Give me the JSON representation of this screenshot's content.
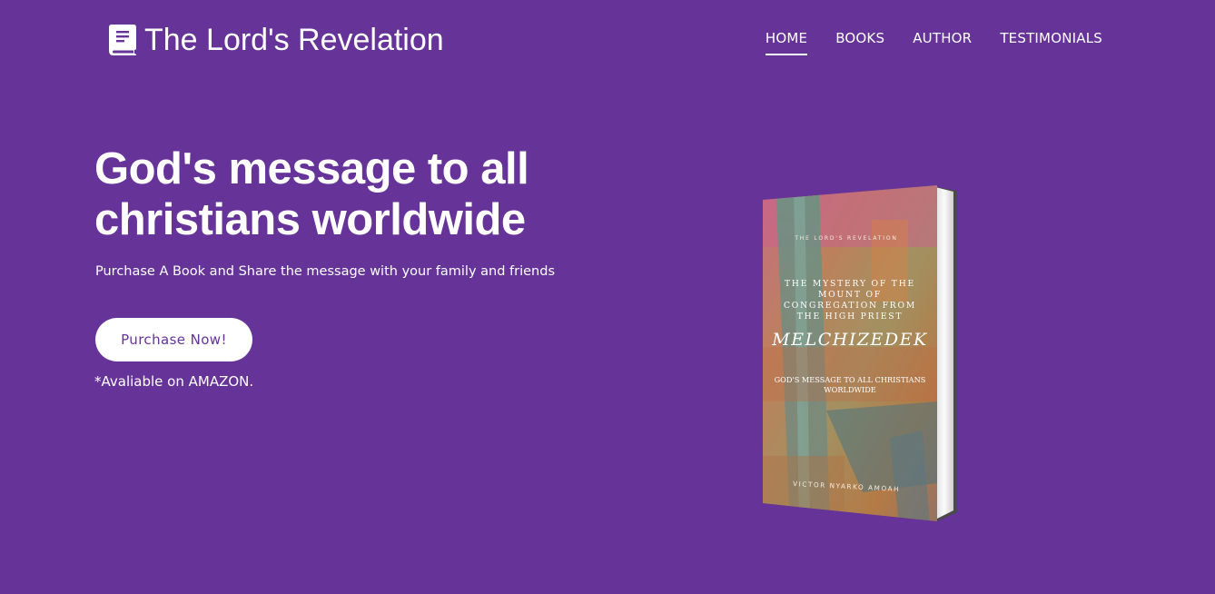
{
  "header": {
    "brand_icon": "book-icon",
    "brand_title": "The Lord's Revelation",
    "nav": [
      {
        "label": "HOME",
        "active": true
      },
      {
        "label": "BOOKS",
        "active": false
      },
      {
        "label": "AUTHOR",
        "active": false
      },
      {
        "label": "TESTIMONIALS",
        "active": false
      }
    ]
  },
  "hero": {
    "title": "God's message to all christians worldwide",
    "subtitle": "Purchase A Book and Share the message with your family and friends",
    "cta_label": "Purchase Now!",
    "note": "*Avaliable on AMAZON."
  },
  "book_cover": {
    "series": "THE LORD'S REVELATION",
    "title_lines": [
      "THE MYSTERY OF THE",
      "MOUNT OF",
      "CONGREGATION FROM",
      "THE HIGH PRIEST"
    ],
    "name": "MELCHIZEDEK",
    "subtitle_lines": [
      "GOD'S MESSAGE TO ALL CHRISTIANS",
      "WORLDWIDE"
    ],
    "author": "VICTOR NYARKO AMOAH"
  },
  "colors": {
    "background": "#663399",
    "accent": "#ffffff",
    "button_text": "#663399"
  }
}
